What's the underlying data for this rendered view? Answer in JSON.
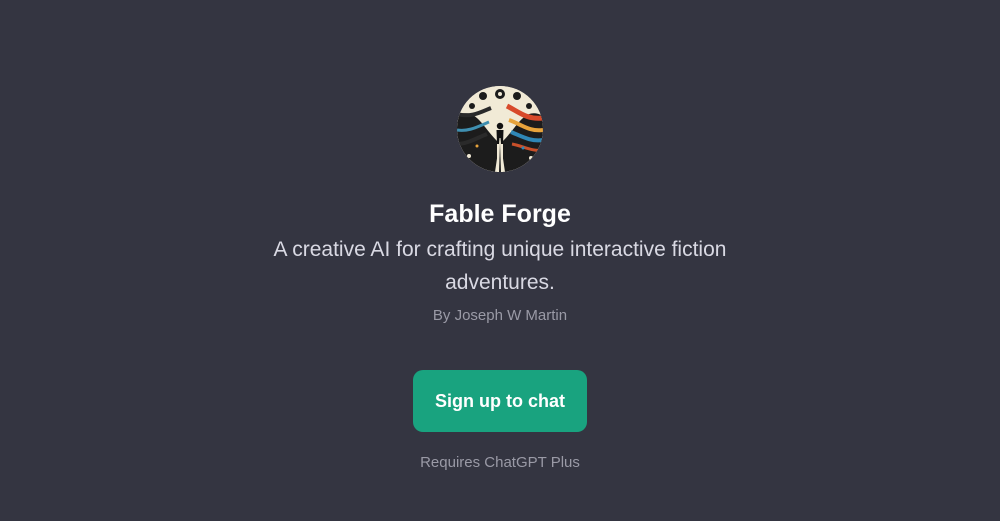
{
  "gpt": {
    "avatar_icon": "fable-forge-logo-icon",
    "name": "Fable Forge",
    "description": "A creative AI for crafting unique interactive fiction adventures.",
    "author": "By Joseph W Martin"
  },
  "cta": {
    "label": "Sign up to chat",
    "color": "#19a37f"
  },
  "note": "Requires ChatGPT Plus",
  "theme": {
    "background": "#343541",
    "title_color": "#ffffff",
    "muted_color": "#9a9aa6"
  }
}
